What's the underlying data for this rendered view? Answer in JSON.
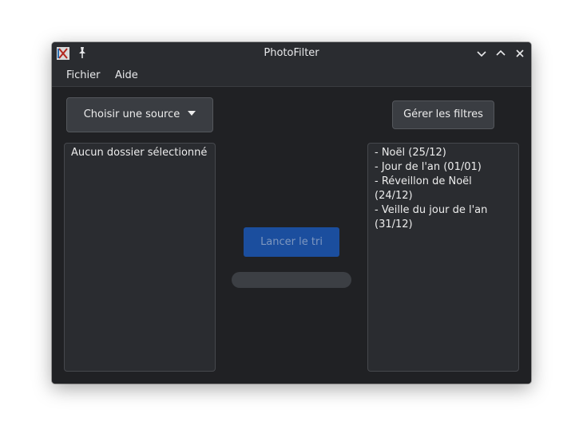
{
  "window": {
    "title": "PhotoFilter",
    "icons": {
      "app": "app-icon",
      "pin": "pin-icon",
      "minimize": "chevron-down-icon",
      "maximize": "chevron-up-icon",
      "close": "close-icon"
    }
  },
  "menu": {
    "items": [
      {
        "label": "Fichier"
      },
      {
        "label": "Aide"
      }
    ]
  },
  "toolbar": {
    "source_label": "Choisir une source",
    "filters_label": "Gérer les filtres"
  },
  "source_panel": {
    "text": "Aucun dossier sélectionné"
  },
  "filters_panel": {
    "items": [
      "- Noël (25/12)",
      "- Jour de l'an (01/01)",
      "- Réveillon de Noël (24/12)",
      "- Veille du jour de l'an (31/12)"
    ]
  },
  "actions": {
    "run_label": "Lancer le tri",
    "run_enabled": false
  },
  "progress": {
    "value": 0
  },
  "colors": {
    "accent": "#1b4e9e",
    "window_bg": "#202124",
    "panel_bg": "#2a2c30",
    "text": "#ececec"
  }
}
